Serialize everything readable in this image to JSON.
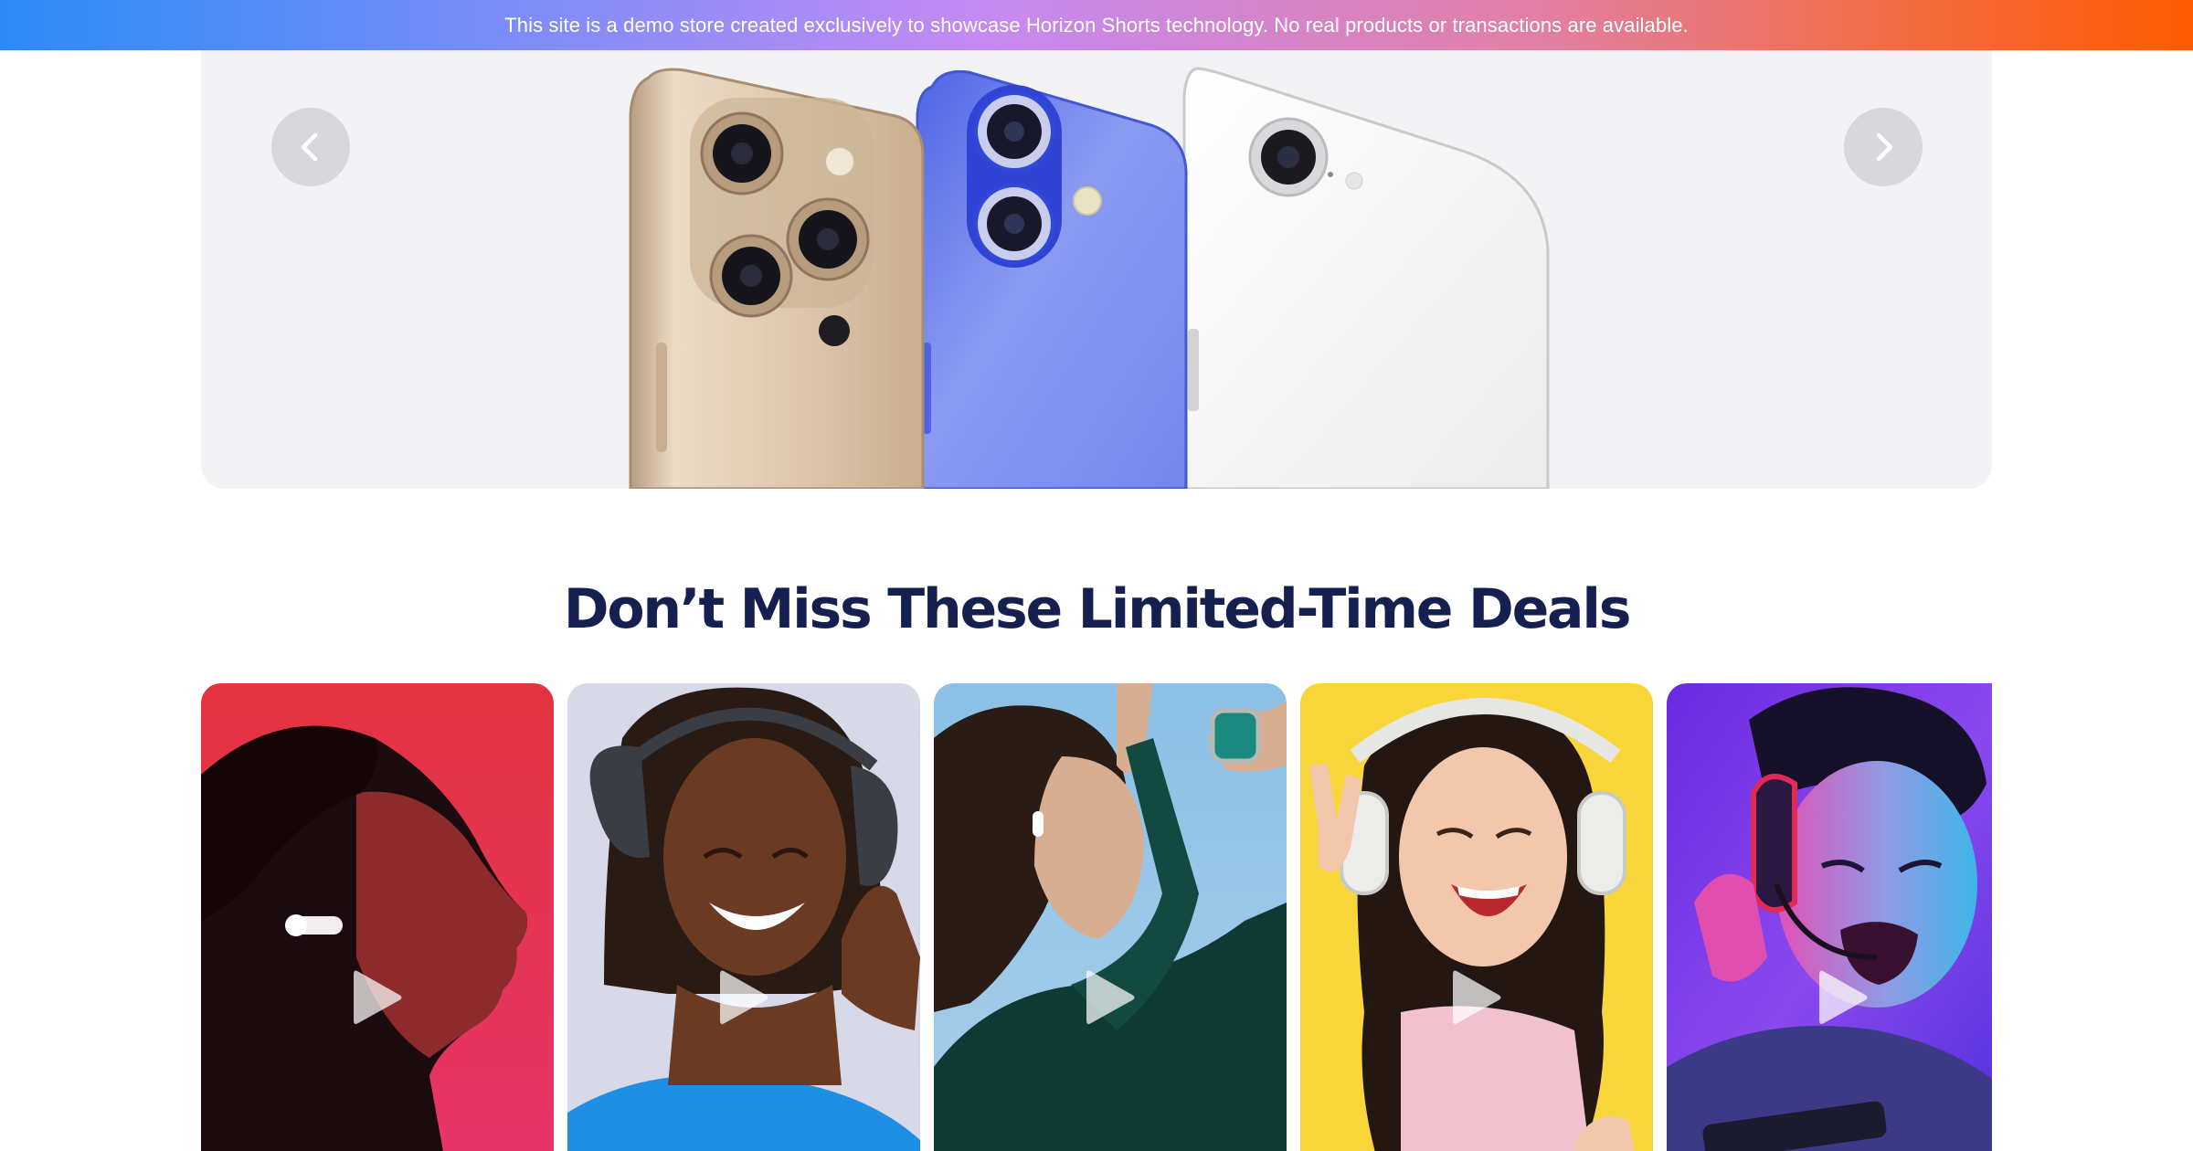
{
  "announcement": {
    "text": "This site is a demo store created exclusively to showcase Horizon Shorts technology. No real products or transactions are available."
  },
  "hero": {
    "prev_icon": "chevron-left-icon",
    "next_icon": "chevron-right-icon",
    "phone_colors": [
      "#d9c2a6",
      "#6f82ef",
      "#eeeeee"
    ]
  },
  "deals": {
    "title": "Don’t Miss These Limited-Time Deals",
    "cards": [
      {
        "background": "#e3334a",
        "icon": "play-icon"
      },
      {
        "background": "#d8d9e8",
        "icon": "play-icon"
      },
      {
        "background": "#9cc6e6",
        "icon": "play-icon"
      },
      {
        "background": "#f9d63a",
        "icon": "play-icon"
      },
      {
        "background": "#7b39e8",
        "icon": "play-icon"
      }
    ]
  }
}
